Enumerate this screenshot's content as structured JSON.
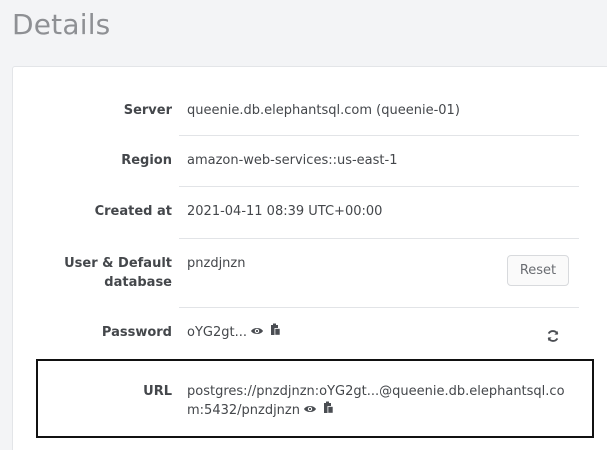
{
  "page": {
    "title": "Details"
  },
  "details": {
    "server": {
      "label": "Server",
      "value": "queenie.db.elephantsql.com (queenie-01)"
    },
    "region": {
      "label": "Region",
      "value": "amazon-web-services::us-east-1"
    },
    "created": {
      "label": "Created at",
      "value": "2021-04-11 08:39 UTC+00:00"
    },
    "user": {
      "label_line1": "User & Default",
      "label_line2": "database",
      "value": "pnzdjnzn",
      "reset_label": "Reset"
    },
    "password": {
      "label": "Password",
      "value": "oYG2gt..."
    },
    "url": {
      "label": "URL",
      "value_line1": "postgres://pnzdjnzn:oYG2gt...@queenie.db.elephantsql.co",
      "value_line2": "m:5432/pnzdjnzn"
    }
  },
  "icons": {
    "show": "eye-icon",
    "copy": "clipboard-icon",
    "refresh": "refresh-icon"
  }
}
